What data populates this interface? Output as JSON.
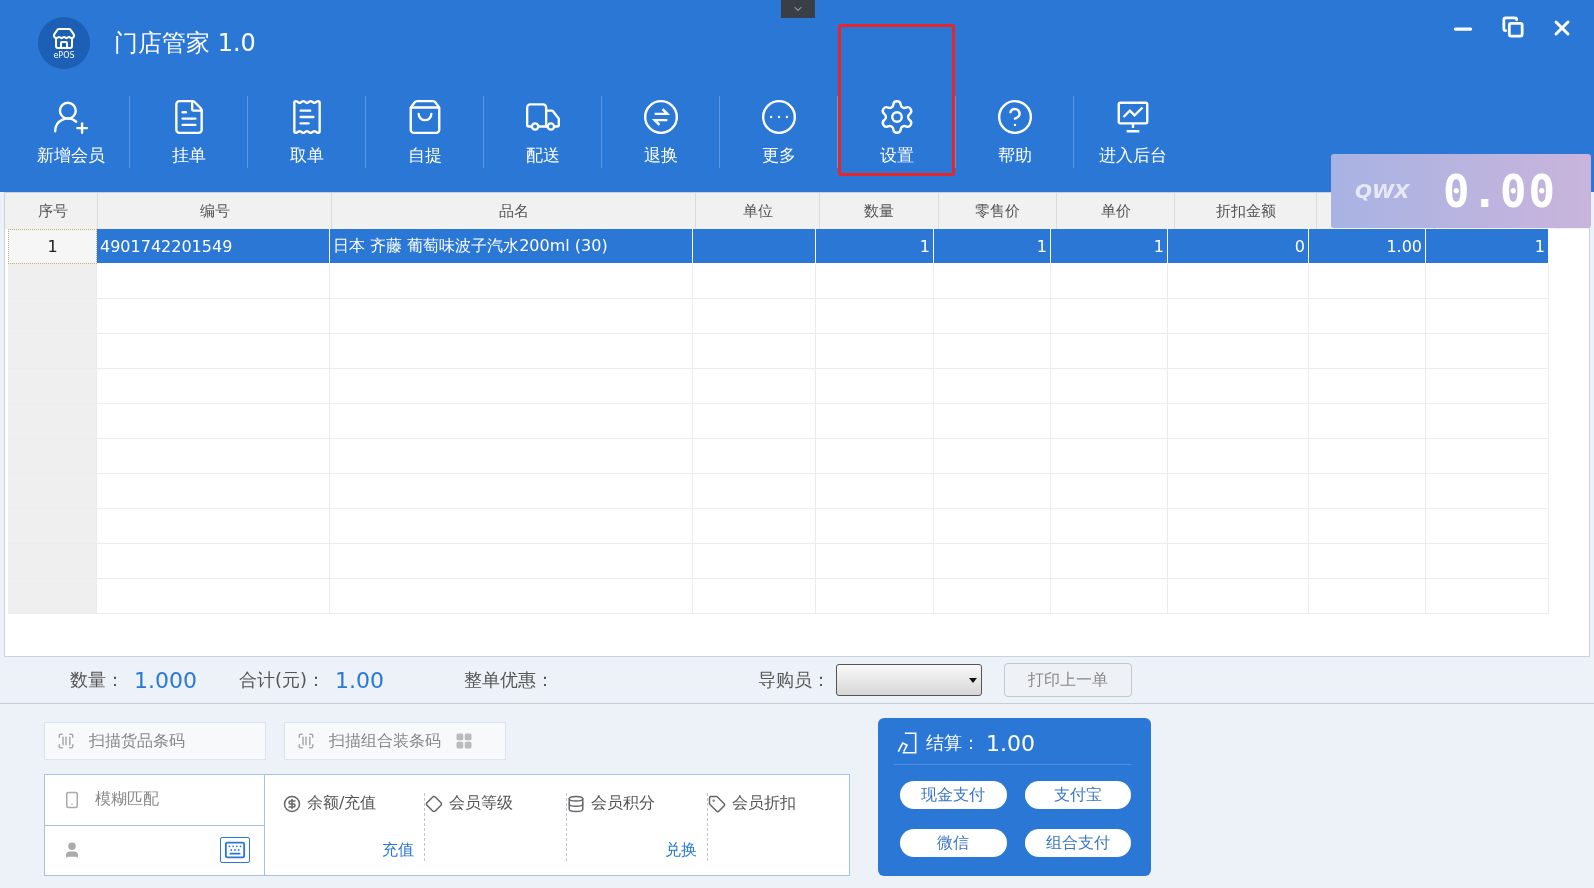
{
  "window": {
    "title": "门店管家 1.0",
    "logo_text": "ePOS"
  },
  "toolbar": [
    {
      "label": "新增会员",
      "highlighted": false
    },
    {
      "label": "挂单",
      "highlighted": false
    },
    {
      "label": "取单",
      "highlighted": false
    },
    {
      "label": "自提",
      "highlighted": false
    },
    {
      "label": "配送",
      "highlighted": false
    },
    {
      "label": "退换",
      "highlighted": false
    },
    {
      "label": "更多",
      "highlighted": false
    },
    {
      "label": "设置",
      "highlighted": true
    },
    {
      "label": "帮助",
      "highlighted": false
    },
    {
      "label": "进入后台",
      "highlighted": false
    }
  ],
  "display": {
    "logo": "QWX",
    "value": "0.00"
  },
  "table": {
    "columns": [
      "序号",
      "编号",
      "品名",
      "单位",
      "数量",
      "零售价",
      "单价",
      "折扣金额"
    ],
    "rows": [
      {
        "index": "1",
        "code": "4901742201549",
        "name": "日本 齐藤 葡萄味波子汽水200ml (30)",
        "quantity": "1",
        "retail_price": "1",
        "unit_price": "1",
        "discount": "0",
        "column_9": "1.00",
        "column_10": "1",
        "selected": true
      }
    ]
  },
  "summary": {
    "quantity_label": "数量：",
    "quantity": "1.000",
    "total_label": "合计(元)：",
    "total": "1.00",
    "discount_label": "整单优惠：",
    "guide_label": "导购员：",
    "print_button": "打印上一单"
  },
  "scan": {
    "goods_placeholder": "扫描货品条码",
    "combo_placeholder": "扫描组合装条码"
  },
  "member": {
    "search_placeholder": "模糊匹配",
    "items": [
      {
        "label": "余额/充值",
        "link": "充值"
      },
      {
        "label": "会员等级"
      },
      {
        "label": "会员积分",
        "link": "兑换"
      },
      {
        "label": "会员折扣"
      }
    ]
  },
  "checkout": {
    "label": "结算：",
    "amount": "1.00",
    "methods": [
      "现金支付",
      "支付宝",
      "微信",
      "组合支付"
    ]
  }
}
